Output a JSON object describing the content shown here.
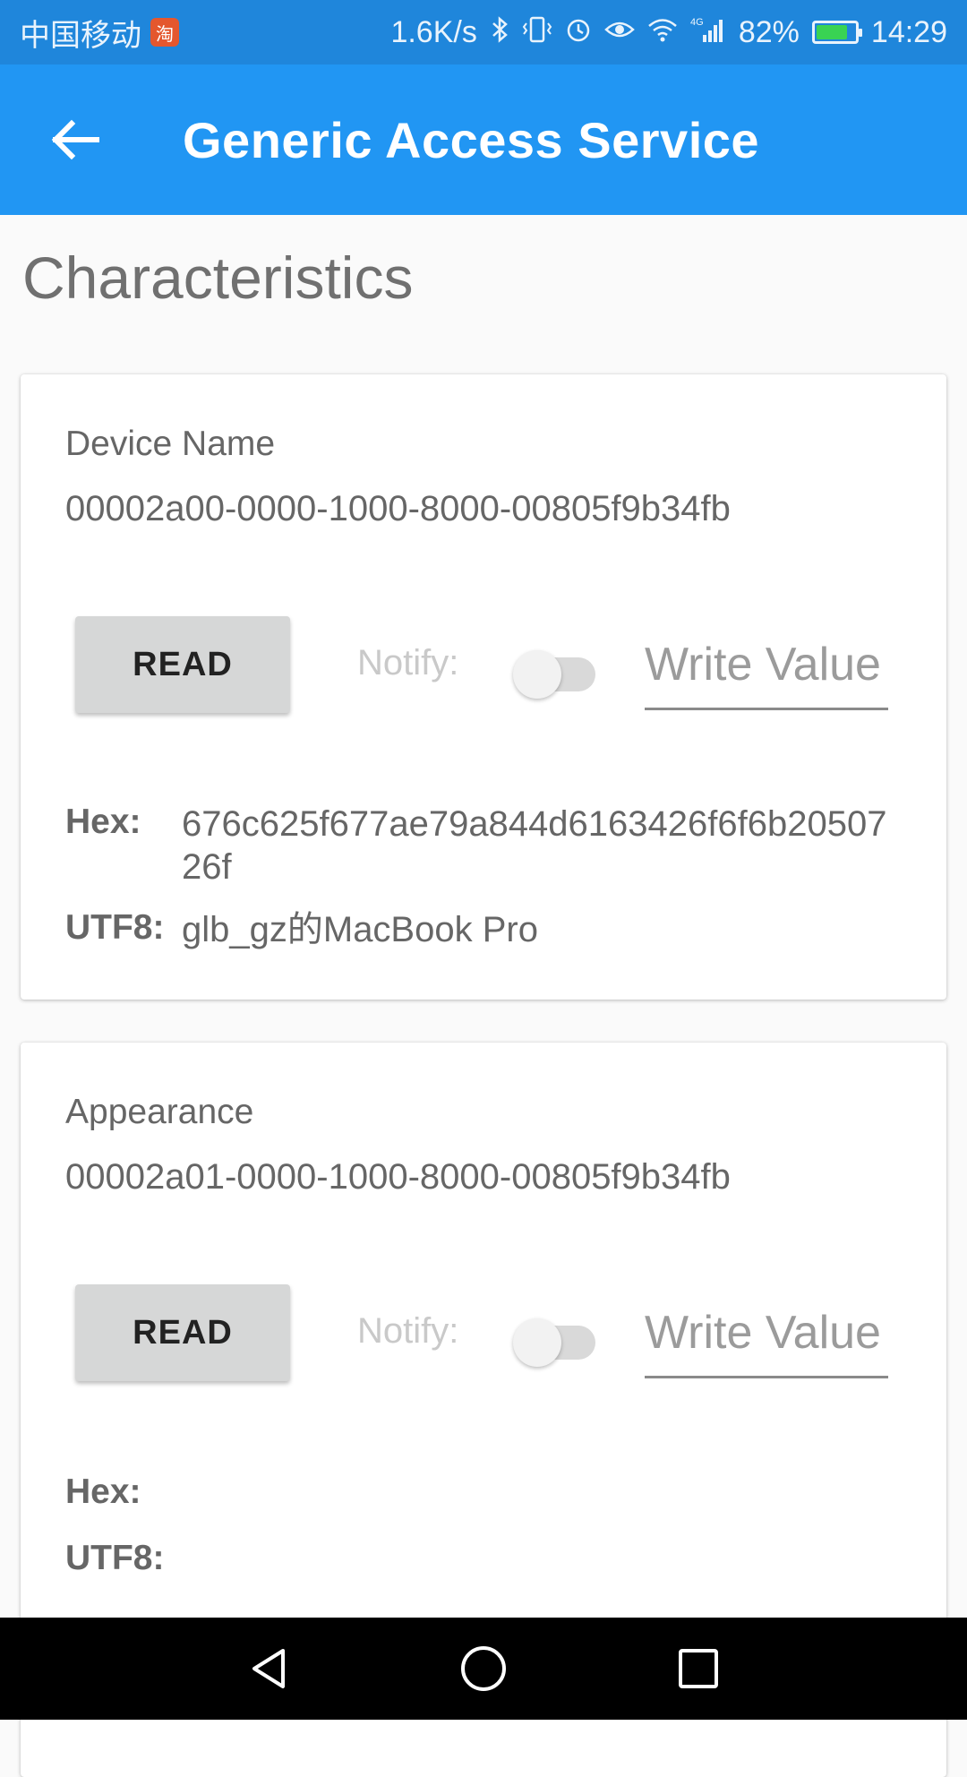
{
  "status_bar": {
    "carrier": "中国移动",
    "app_badge": "淘",
    "network_speed": "1.6K/s",
    "signal_type": "4G",
    "battery_percent": "82%",
    "battery_level": 0.82,
    "time": "14:29",
    "icons": [
      "bluetooth-icon",
      "vibrate-icon",
      "alarm-icon",
      "eye-comfort-icon",
      "wifi-icon",
      "cell-signal-icon",
      "battery-icon"
    ]
  },
  "app_bar": {
    "title": "Generic Access Service",
    "back_icon": "arrow-left-icon"
  },
  "section_title": "Characteristics",
  "characteristics": [
    {
      "name": "Device Name",
      "uuid": "00002a00-0000-1000-8000-00805f9b34fb",
      "read_label": "READ",
      "notify_label": "Notify:",
      "notify_on": false,
      "write_placeholder": "Write Value",
      "hex_label": "Hex:",
      "hex_value": "676c625f677ae79a844d6163426f6f6b2050726f",
      "utf8_label": "UTF8:",
      "utf8_value": "glb_gz的MacBook Pro"
    },
    {
      "name": "Appearance",
      "uuid": "00002a01-0000-1000-8000-00805f9b34fb",
      "read_label": "READ",
      "notify_label": "Notify:",
      "notify_on": false,
      "write_placeholder": "Write Value",
      "hex_label": "Hex:",
      "hex_value": "",
      "utf8_label": "UTF8:",
      "utf8_value": ""
    }
  ],
  "nav_bar": {
    "icons": [
      "nav-back-icon",
      "nav-home-icon",
      "nav-recents-icon"
    ]
  },
  "colors": {
    "app_bar": "#2196f3",
    "status_bar": "#1f86db",
    "read_button": "#d6d7d7",
    "battery_fill": "#39d353"
  }
}
